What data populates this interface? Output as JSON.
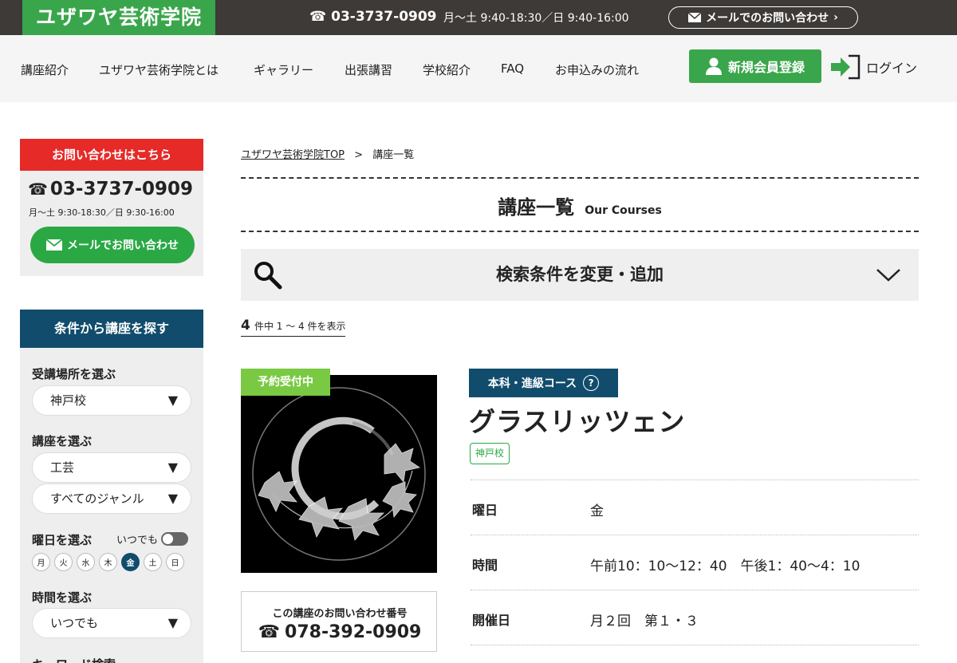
{
  "header": {
    "logo": "ユザワヤ芸術学院",
    "phone": "03-3737-0909",
    "hours": "月〜土 9:40-18:30／日 9:40-16:00",
    "mail_label": "メールでのお問い合わせ",
    "colors": {
      "topbar": "#3d3a38",
      "brand_green": "#3aa64b"
    }
  },
  "nav": {
    "items": [
      {
        "label": "講座紹介"
      },
      {
        "label": "ユザワヤ芸術学院とは"
      },
      {
        "label": "ギャラリー"
      },
      {
        "label": "出張講習"
      },
      {
        "label": "学校紹介"
      },
      {
        "label": "FAQ"
      },
      {
        "label": "お申込みの流れ"
      }
    ],
    "register_label": "新規会員登録",
    "login_label": "ログイン"
  },
  "sidebar": {
    "contact": {
      "heading": "お問い合わせはこちら",
      "phone": "03-3737-0909",
      "hours": "月〜土 9:30-18:30／日 9:30-16:00",
      "mail_label": "メールでお問い合わせ"
    },
    "search": {
      "heading": "条件から講座を探す",
      "location_label": "受講場所を選ぶ",
      "location_value": "神戸校",
      "course_label": "講座を選ぶ",
      "course_value": "工芸",
      "genre_value": "すべてのジャンル",
      "day_label": "曜日を選ぶ",
      "anyday_label": "いつでも",
      "days": [
        "月",
        "火",
        "水",
        "木",
        "金",
        "土",
        "日"
      ],
      "selected_day": "金",
      "time_label": "時間を選ぶ",
      "time_value": "いつでも",
      "keyword_label": "キーワード検索"
    }
  },
  "breadcrumb": {
    "home": "ユザワヤ芸術学院TOP",
    "separator": ">",
    "current": "講座一覧"
  },
  "page": {
    "title": "講座一覧",
    "subtitle": "Our Courses",
    "filter_label": "検索条件を変更・追加",
    "result_count": "4",
    "result_text": "件中 1 〜 4 件を表示"
  },
  "course": {
    "status": "予約受付中",
    "category": "本科・進級コース",
    "name": "グラスリッツェン",
    "location": "神戸校",
    "inquiry_label": "この講座のお問い合わせ番号",
    "inquiry_phone": "078-392-0909",
    "details": [
      {
        "key": "曜日",
        "value": "金"
      },
      {
        "key": "時間",
        "value": "午前10：10〜12：40　午後1：40〜4：10"
      },
      {
        "key": "開催日",
        "value": "月２回　第１・３"
      }
    ],
    "colors": {
      "status": "#7ac943",
      "category": "#114c6c",
      "location": "#2aa844"
    }
  }
}
